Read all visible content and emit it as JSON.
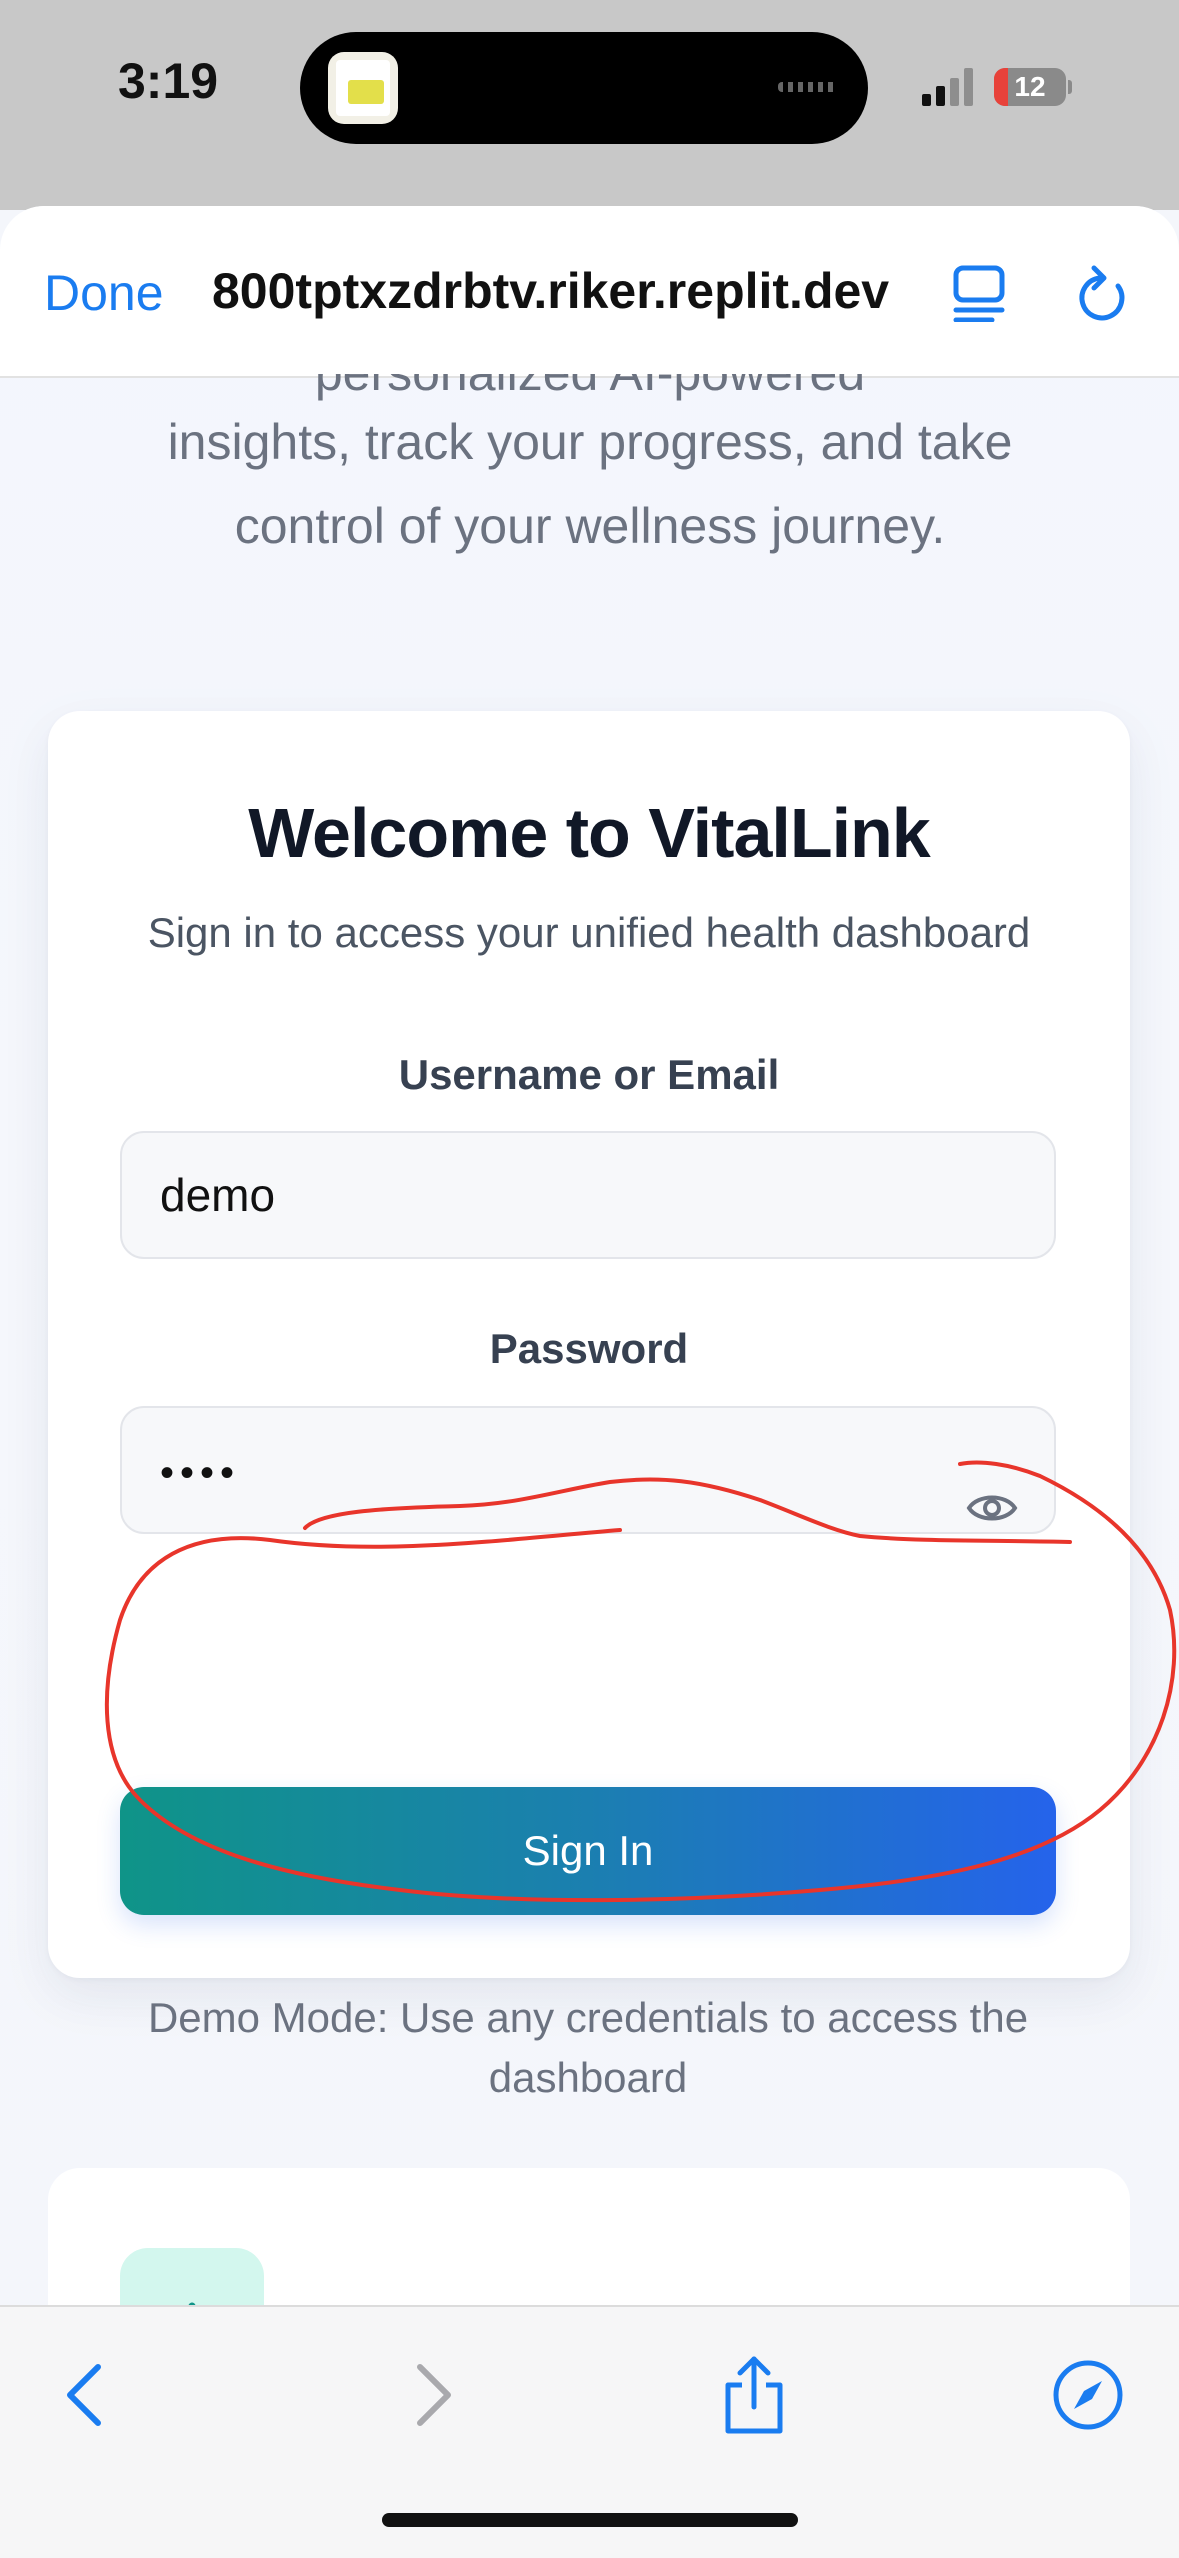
{
  "status_bar": {
    "time": "3:19",
    "battery_percent": "12"
  },
  "browser": {
    "done_label": "Done",
    "url": "800tptxzdrbtv.riker.replit.dev"
  },
  "hero": {
    "line_cutoff": "personalized AI-powered",
    "text": "insights, track your progress, and take control of your wellness journey."
  },
  "login_card": {
    "title": "Welcome to VitalLink",
    "subtitle": "Sign in to access your unified health dashboard",
    "username_label": "Username or Email",
    "username_value": "demo",
    "password_label": "Password",
    "password_value": "••••",
    "sign_in_label": "Sign In",
    "demo_note": "Demo Mode: Use any credentials to access the dashboard"
  },
  "colors": {
    "accent": "#1a7cf0",
    "button_gradient_start": "#0f9488",
    "button_gradient_end": "#2563eb",
    "annotation": "#e8352b"
  }
}
